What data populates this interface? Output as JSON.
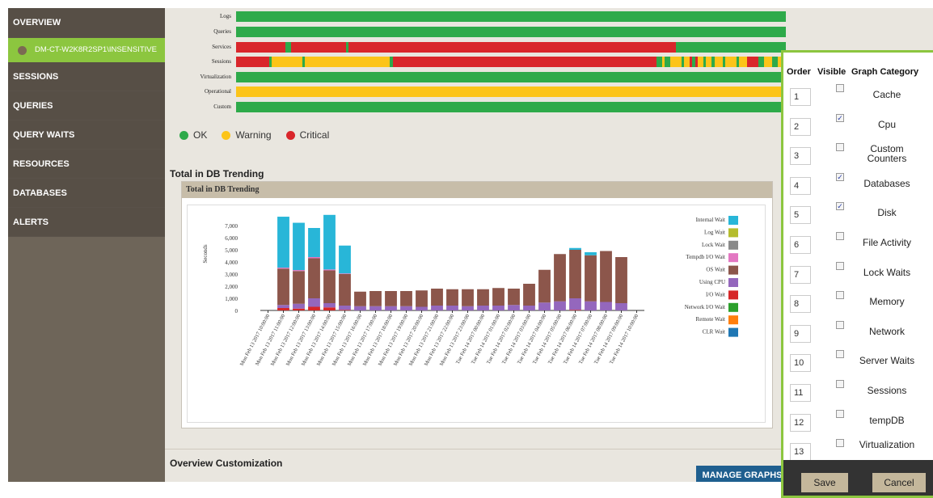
{
  "sidebar": {
    "items": [
      {
        "label": "OVERVIEW"
      },
      {
        "label": "SESSIONS"
      },
      {
        "label": "QUERIES"
      },
      {
        "label": "QUERY WAITS"
      },
      {
        "label": "RESOURCES"
      },
      {
        "label": "DATABASES"
      },
      {
        "label": "ALERTS"
      }
    ],
    "instance": "DM-CT-W2K8R2SP1\\INSENSITIVE"
  },
  "status": {
    "colors": {
      "ok": "#2eaa4a",
      "warning": "#fcc419",
      "critical": "#d9262b"
    },
    "rows": [
      {
        "label": "Logs",
        "segments": [
          [
            "ok",
            0,
            1
          ]
        ]
      },
      {
        "label": "Queries",
        "segments": [
          [
            "ok",
            0,
            1
          ]
        ]
      },
      {
        "label": "Services",
        "segments": [
          [
            "critical",
            0,
            0.09
          ],
          [
            "ok",
            0.09,
            0.1
          ],
          [
            "critical",
            0.1,
            0.2
          ],
          [
            "ok",
            0.2,
            0.205
          ],
          [
            "critical",
            0.205,
            0.8
          ],
          [
            "ok",
            0.8,
            1
          ]
        ]
      },
      {
        "label": "Sessions",
        "segments": [
          [
            "critical",
            0,
            0.06
          ],
          [
            "ok",
            0.06,
            0.065
          ],
          [
            "warning",
            0.065,
            0.12
          ],
          [
            "ok",
            0.12,
            0.125
          ],
          [
            "warning",
            0.125,
            0.28
          ],
          [
            "ok",
            0.28,
            0.285
          ],
          [
            "critical",
            0.285,
            0.765
          ],
          [
            "ok",
            0.765,
            0.775
          ],
          [
            "warning",
            0.775,
            0.78
          ],
          [
            "ok",
            0.78,
            0.79
          ],
          [
            "warning",
            0.79,
            0.81
          ],
          [
            "ok",
            0.81,
            0.815
          ],
          [
            "warning",
            0.815,
            0.825
          ],
          [
            "critical",
            0.825,
            0.83
          ],
          [
            "ok",
            0.83,
            0.835
          ],
          [
            "critical",
            0.835,
            0.84
          ],
          [
            "warning",
            0.84,
            0.85
          ],
          [
            "ok",
            0.85,
            0.855
          ],
          [
            "warning",
            0.855,
            0.865
          ],
          [
            "ok",
            0.865,
            0.87
          ],
          [
            "warning",
            0.87,
            0.885
          ],
          [
            "ok",
            0.885,
            0.89
          ],
          [
            "warning",
            0.89,
            0.91
          ],
          [
            "ok",
            0.91,
            0.915
          ],
          [
            "warning",
            0.915,
            0.93
          ],
          [
            "critical",
            0.93,
            0.95
          ],
          [
            "ok",
            0.95,
            0.96
          ],
          [
            "warning",
            0.96,
            0.975
          ],
          [
            "ok",
            0.975,
            0.985
          ],
          [
            "warning",
            0.985,
            1
          ]
        ]
      },
      {
        "label": "Virtualization",
        "segments": [
          [
            "ok",
            0,
            1
          ]
        ]
      },
      {
        "label": "Operational",
        "segments": [
          [
            "warning",
            0,
            1
          ]
        ]
      },
      {
        "label": "Custom",
        "segments": [
          [
            "ok",
            0,
            1
          ]
        ]
      }
    ],
    "legend": [
      {
        "label": "OK",
        "color": "#2eaa4a"
      },
      {
        "label": "Warning",
        "color": "#fcc419"
      },
      {
        "label": "Critical",
        "color": "#d9262b"
      }
    ]
  },
  "trend": {
    "section_title": "Total in DB Trending",
    "panel_title": "Total in DB Trending"
  },
  "chart_data": {
    "type": "bar",
    "ylabel": "Seconds",
    "ylim": [
      0,
      8000
    ],
    "yticks": [
      "0",
      "1,000",
      "2,000",
      "3,000",
      "4,000",
      "5,000",
      "6,000",
      "7,000"
    ],
    "categories": [
      "Mon Feb 13 2017 10:00:00",
      "Mon Feb 13 2017 11:00:00",
      "Mon Feb 13 2017 12:00:00",
      "Mon Feb 13 2017 13:00:00",
      "Mon Feb 13 2017 14:00:00",
      "Mon Feb 13 2017 15:00:00",
      "Mon Feb 13 2017 16:00:00",
      "Mon Feb 13 2017 17:00:00",
      "Mon Feb 13 2017 18:00:00",
      "Mon Feb 13 2017 19:00:00",
      "Mon Feb 13 2017 20:00:00",
      "Mon Feb 13 2017 21:00:00",
      "Mon Feb 13 2017 22:00:00",
      "Mon Feb 13 2017 23:00:00",
      "Tue Feb 14 2017 00:00:00",
      "Tue Feb 14 2017 01:00:00",
      "Tue Feb 14 2017 02:00:00",
      "Tue Feb 14 2017 03:00:00",
      "Tue Feb 14 2017 04:00:00",
      "Tue Feb 14 2017 05:00:00",
      "Tue Feb 14 2017 06:00:00",
      "Tue Feb 14 2017 07:00:00",
      "Tue Feb 14 2017 08:00:00",
      "Tue Feb 14 2017 09:00:00",
      "Tue Feb 14 2017 10:00:00"
    ],
    "series": [
      {
        "name": "Internal Wait",
        "color": "#28b6d8",
        "values": [
          0,
          4200,
          3900,
          2400,
          4500,
          2300,
          0,
          0,
          0,
          0,
          0,
          0,
          0,
          0,
          0,
          0,
          0,
          0,
          0,
          0,
          150,
          250,
          0,
          0,
          0
        ]
      },
      {
        "name": "Log Wait",
        "color": "#b5bd2d",
        "values": [
          0,
          0,
          0,
          0,
          0,
          0,
          0,
          0,
          0,
          0,
          0,
          0,
          0,
          0,
          0,
          0,
          0,
          0,
          0,
          0,
          0,
          0,
          0,
          0,
          0
        ]
      },
      {
        "name": "Lock Wait",
        "color": "#8a8a8a",
        "values": [
          0,
          0,
          0,
          0,
          0,
          0,
          0,
          0,
          0,
          0,
          0,
          0,
          0,
          0,
          0,
          0,
          0,
          0,
          0,
          0,
          0,
          0,
          0,
          0,
          0
        ]
      },
      {
        "name": "Tempdb I/O Wait",
        "color": "#e377c2",
        "values": [
          0,
          80,
          80,
          100,
          80,
          50,
          0,
          0,
          0,
          0,
          0,
          0,
          0,
          0,
          0,
          0,
          0,
          0,
          0,
          0,
          0,
          0,
          0,
          0,
          0
        ]
      },
      {
        "name": "OS Wait",
        "color": "#8c564b",
        "values": [
          0,
          3000,
          2700,
          3300,
          2700,
          2600,
          1200,
          1250,
          1250,
          1250,
          1350,
          1400,
          1350,
          1400,
          1350,
          1450,
          1350,
          1800,
          2700,
          3900,
          4000,
          3800,
          4200,
          3800,
          0
        ]
      },
      {
        "name": "Using CPU",
        "color": "#9467bd",
        "values": [
          0,
          250,
          400,
          700,
          350,
          350,
          350,
          350,
          350,
          350,
          300,
          400,
          400,
          350,
          400,
          400,
          450,
          400,
          650,
          750,
          950,
          750,
          700,
          600,
          0
        ]
      },
      {
        "name": "I/O Wait",
        "color": "#d62728",
        "values": [
          0,
          200,
          150,
          300,
          250,
          50,
          0,
          0,
          0,
          0,
          0,
          0,
          0,
          0,
          0,
          0,
          0,
          0,
          0,
          0,
          50,
          0,
          0,
          0,
          0
        ]
      },
      {
        "name": "Network I/O Wait",
        "color": "#2ca02c",
        "values": [
          0,
          0,
          0,
          0,
          0,
          0,
          0,
          0,
          0,
          0,
          0,
          0,
          0,
          0,
          0,
          0,
          0,
          0,
          0,
          0,
          0,
          0,
          0,
          0,
          0
        ]
      },
      {
        "name": "Remote Wait",
        "color": "#ff7f0e",
        "values": [
          0,
          0,
          0,
          0,
          0,
          0,
          0,
          0,
          0,
          0,
          0,
          0,
          0,
          0,
          0,
          0,
          0,
          0,
          0,
          0,
          0,
          0,
          0,
          0,
          0
        ]
      },
      {
        "name": "CLR Wait",
        "color": "#1f77b4",
        "values": [
          0,
          0,
          0,
          0,
          0,
          0,
          0,
          0,
          0,
          0,
          0,
          0,
          0,
          0,
          0,
          0,
          0,
          0,
          0,
          0,
          0,
          0,
          0,
          0,
          0
        ]
      }
    ]
  },
  "customization": {
    "label": "Overview Customization",
    "manage_button": "MANAGE GRAPHS"
  },
  "dialog": {
    "headers": {
      "order": "Order",
      "visible": "Visible",
      "category": "Graph Category"
    },
    "rows": [
      {
        "order": "1",
        "checked": false,
        "category": "Cache"
      },
      {
        "order": "2",
        "checked": true,
        "category": "Cpu"
      },
      {
        "order": "3",
        "checked": false,
        "category": "Custom Counters"
      },
      {
        "order": "4",
        "checked": true,
        "category": "Databases"
      },
      {
        "order": "5",
        "checked": true,
        "category": "Disk"
      },
      {
        "order": "6",
        "checked": false,
        "category": "File Activity"
      },
      {
        "order": "7",
        "checked": false,
        "category": "Lock Waits"
      },
      {
        "order": "8",
        "checked": false,
        "category": "Memory"
      },
      {
        "order": "9",
        "checked": false,
        "category": "Network"
      },
      {
        "order": "10",
        "checked": false,
        "category": "Server Waits"
      },
      {
        "order": "11",
        "checked": false,
        "category": "Sessions"
      },
      {
        "order": "12",
        "checked": false,
        "category": "tempDB"
      },
      {
        "order": "13",
        "checked": false,
        "category": "Virtualization"
      }
    ],
    "save_label": "Save",
    "cancel_label": "Cancel"
  }
}
